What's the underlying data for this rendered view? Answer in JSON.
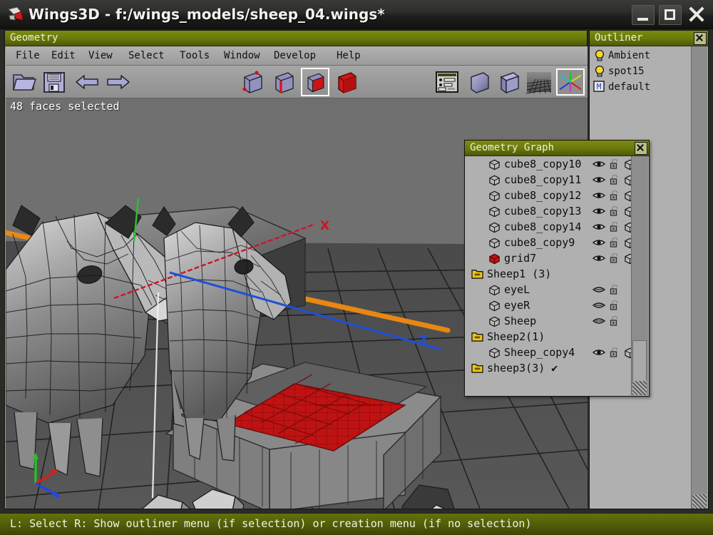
{
  "window": {
    "title": "Wings3D - f:/wings_models/sheep_04.wings*",
    "icon": "wings3d-logo-icon",
    "minimize_label": "",
    "maximize_label": "",
    "close_label": ""
  },
  "geometry_window": {
    "panel_title": "Geometry",
    "menu": [
      {
        "label": "File"
      },
      {
        "label": "Edit"
      },
      {
        "label": "View"
      },
      {
        "label": "Select"
      },
      {
        "label": "Tools"
      },
      {
        "label": "Window"
      },
      {
        "label": "Develop"
      },
      {
        "label": "Help"
      }
    ],
    "toolbar": {
      "open_icon": "open-folder-icon",
      "save_icon": "save-floppy-icon",
      "undo_icon": "undo-left-arrow-icon",
      "redo_icon": "redo-right-arrow-icon",
      "select_modes": [
        {
          "name": "vertex-select-mode",
          "active": false
        },
        {
          "name": "edge-select-mode",
          "active": false
        },
        {
          "name": "face-select-mode",
          "active": true
        },
        {
          "name": "body-select-mode",
          "active": false
        }
      ],
      "view_modes": [
        {
          "name": "preferences-icon",
          "active": false
        },
        {
          "name": "smooth-shade-icon",
          "active": false
        },
        {
          "name": "flat-shade-icon",
          "active": false
        },
        {
          "name": "wireframe-grid-icon",
          "active": false
        },
        {
          "name": "show-axes-icon",
          "active": true
        }
      ]
    },
    "viewport": {
      "status": "48 faces selected",
      "axis_labels": [
        {
          "text": "X",
          "color": "#c8102e"
        },
        {
          "text": "Z",
          "color": "#1f4fd8"
        }
      ],
      "selection_color": "#c81414",
      "highlight_edge_color": "#f08a10",
      "background_color": "#6d6d6d",
      "floor_color": "#4c4c4c"
    }
  },
  "outliner": {
    "panel_title": "Outliner",
    "close_label": "",
    "items": [
      {
        "label": "Ambient",
        "icon": "light-bulb-icon"
      },
      {
        "label": "spot15",
        "icon": "light-bulb-icon"
      },
      {
        "label": "default",
        "icon": "material-m-icon"
      }
    ]
  },
  "geometry_graph": {
    "panel_title": "Geometry Graph",
    "close_label": "",
    "items": [
      {
        "label": "cube8_copy10",
        "icon": "wire-cube-icon",
        "indent": 1,
        "eye": "open",
        "lock": "unlocked",
        "wire": true,
        "selected": false
      },
      {
        "label": "cube8_copy11",
        "icon": "wire-cube-icon",
        "indent": 1,
        "eye": "open",
        "lock": "unlocked",
        "wire": true,
        "selected": false
      },
      {
        "label": "cube8_copy12",
        "icon": "wire-cube-icon",
        "indent": 1,
        "eye": "open",
        "lock": "unlocked",
        "wire": true,
        "selected": false
      },
      {
        "label": "cube8_copy13",
        "icon": "wire-cube-icon",
        "indent": 1,
        "eye": "open",
        "lock": "unlocked",
        "wire": true,
        "selected": false
      },
      {
        "label": "cube8_copy14",
        "icon": "wire-cube-icon",
        "indent": 1,
        "eye": "open",
        "lock": "unlocked",
        "wire": true,
        "selected": false
      },
      {
        "label": "cube8_copy9",
        "icon": "wire-cube-icon",
        "indent": 1,
        "eye": "open",
        "lock": "unlocked",
        "wire": true,
        "selected": false
      },
      {
        "label": "grid7",
        "icon": "red-cube-icon",
        "indent": 1,
        "eye": "open",
        "lock": "unlocked",
        "wire": true,
        "selected": true
      },
      {
        "label": "Sheep1 (3)",
        "icon": "folder-icon",
        "indent": 0,
        "eye": "none",
        "lock": "none",
        "wire": false,
        "selected": false
      },
      {
        "label": "eyeL",
        "icon": "wire-cube-icon",
        "indent": 1,
        "eye": "closed",
        "lock": "unlocked",
        "wire": false,
        "selected": false
      },
      {
        "label": "eyeR",
        "icon": "wire-cube-icon",
        "indent": 1,
        "eye": "closed",
        "lock": "unlocked",
        "wire": false,
        "selected": false
      },
      {
        "label": "Sheep",
        "icon": "wire-cube-icon",
        "indent": 1,
        "eye": "closed",
        "lock": "unlocked",
        "wire": false,
        "selected": false
      },
      {
        "label": "Sheep2(1)",
        "icon": "folder-icon",
        "indent": 0,
        "eye": "none",
        "lock": "none",
        "wire": false,
        "selected": false
      },
      {
        "label": "Sheep_copy4",
        "icon": "wire-cube-icon",
        "indent": 1,
        "eye": "open",
        "lock": "unlocked",
        "wire": true,
        "selected": false
      },
      {
        "label": "sheep3(3) ✔",
        "icon": "folder-icon",
        "indent": 0,
        "eye": "none",
        "lock": "none",
        "wire": false,
        "selected": false
      }
    ]
  },
  "statusbar": {
    "text": "L: Select   R: Show outliner menu (if selection) or creation menu (if no selection)"
  }
}
